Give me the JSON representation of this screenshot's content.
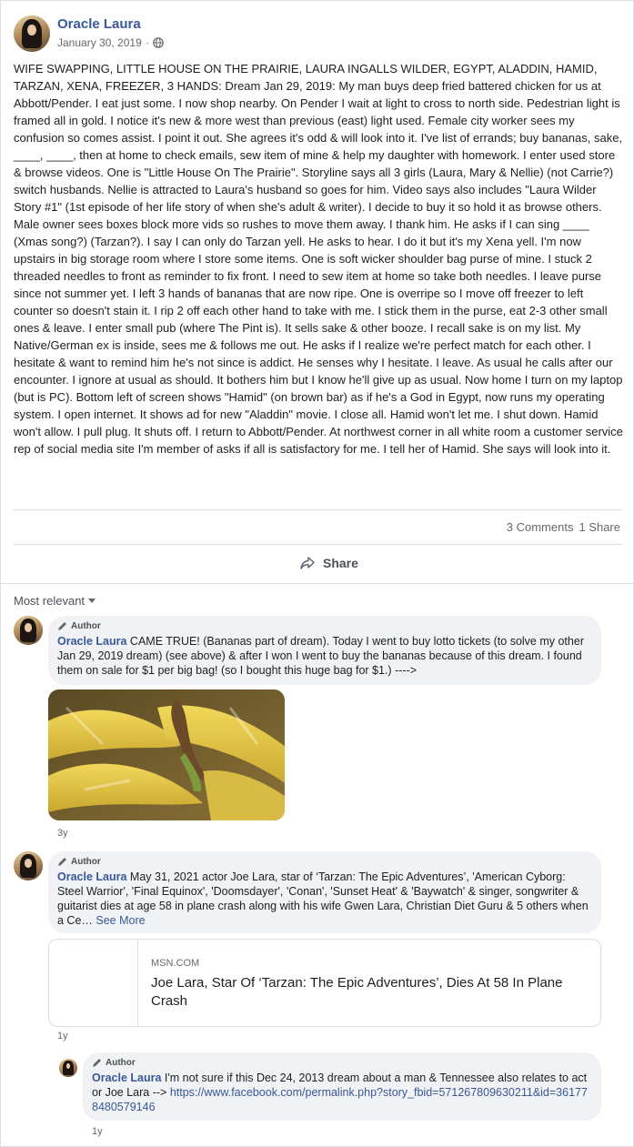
{
  "post": {
    "author": "Oracle Laura",
    "date": "January 30, 2019",
    "privacy_icon": "globe-icon",
    "text": "WIFE SWAPPING, LITTLE HOUSE ON THE PRAIRIE, LAURA INGALLS WILDER, EGYPT, ALADDIN, HAMID, TARZAN, XENA, FREEZER, 3 HANDS: Dream Jan 29, 2019: My man buys deep fried battered chicken for us at Abbott/Pender. I eat just some. I now shop nearby. On Pender I wait at light to cross to north side. Pedestrian light is framed all in gold. I notice it's new & more west than previous (east) light used. Female city worker sees my confusion so comes assist. I point it out. She agrees it's odd & will look into it. I've list of errands; buy bananas, sake, ____, ____, then at home to check emails, sew item of mine & help my daughter with homework. I enter used store & browse videos. One is \"Little House On The Prairie\". Storyline says all 3 girls (Laura, Mary & Nellie) (not Carrie?) switch husbands. Nellie is attracted to Laura's husband so goes for him. Video says also includes \"Laura Wilder Story #1\" (1st episode of her life story of when she's adult & writer). I decide to buy it so hold it as browse others. Male owner sees boxes block more vids so rushes to move them away. I thank him. He asks if I can sing ____ (Xmas song?) (Tarzan?). I say I can only do Tarzan yell. He asks to hear. I do it but it's my Xena yell. I'm now upstairs in big storage room where I store some items. One is soft wicker shoulder bag purse of mine. I stuck 2 threaded needles to front as reminder to fix front. I need to sew item at home so take both needles. I leave purse since not summer yet. I left 3 hands of bananas that are now ripe. One is overripe so I move off freezer to left counter so doesn't stain it. I rip 2 off each other hand to take with me. I stick them in the purse, eat 2-3 other small ones & leave. I enter small pub (where The Pint is). It sells sake & other booze. I recall sake is on my list. My Native/German ex is inside, sees me & follows me out. He asks if I realize we're perfect match for each other. I hesitate & want to remind him he's not since is addict. He senses why I hesitate. I leave. As usual he calls after our encounter. I ignore at usual as should. It bothers him but I know he'll give up as usual. Now home I turn on my laptop (but is PC). Bottom left of screen shows \"Hamid\" (on brown bar) as if he's a God in Egypt, now runs my operating system. I open internet. It shows ad for new \"Aladdin\" movie. I close all. Hamid won't let me. I shut down. Hamid won't allow. I pull plug. It shuts off. I return to Abbott/Pender. At northwest corner in all white room a customer service rep of social media site I'm member of asks if all is satisfactory for me. I tell her of Hamid. She says will look into it.",
    "comments_count": "3 Comments",
    "shares_count": "1 Share",
    "share_label": "Share"
  },
  "comments_sort": "Most relevant",
  "comments": [
    {
      "badge": "Author",
      "author": "Oracle Laura",
      "text": "CAME TRUE! (Bananas part of dream). Today I went to buy lotto tickets (to solve my other Jan 29, 2019 dream) (see above) & after I won I went to buy the bananas because of this dream. I found them on sale for $1 per big bag! (so I bought this huge bag for $1.) ---->",
      "time": "3y"
    },
    {
      "badge": "Author",
      "author": "Oracle Laura",
      "text": "May 31, 2021 actor Joe Lara, star of ‘Tarzan: The Epic Adventures’, 'American Cyborg: Steel Warrior', 'Final Equinox', 'Doomsdayer', 'Conan', 'Sunset Heat' & 'Baywatch' & singer, songwriter & guitarist dies at age 58 in plane crash along with his wife Gwen Lara, Christian Diet Guru & 5 others when a Ce…",
      "see_more": "See More",
      "link": {
        "domain": "MSN.COM",
        "title": "Joe Lara, Star Of ‘Tarzan: The Epic Adventures’, Dies At 58 In Plane Crash"
      },
      "time": "1y"
    },
    {
      "badge": "Author",
      "author": "Oracle Laura",
      "text": "I'm not sure if this Dec 24, 2013 dream about a man & Tennessee also relates to actor Joe Lara -->",
      "url": "https://www.facebook.com/permalink.php?story_fbid=571267809630211&id=361778480579146",
      "time": "1y"
    }
  ]
}
